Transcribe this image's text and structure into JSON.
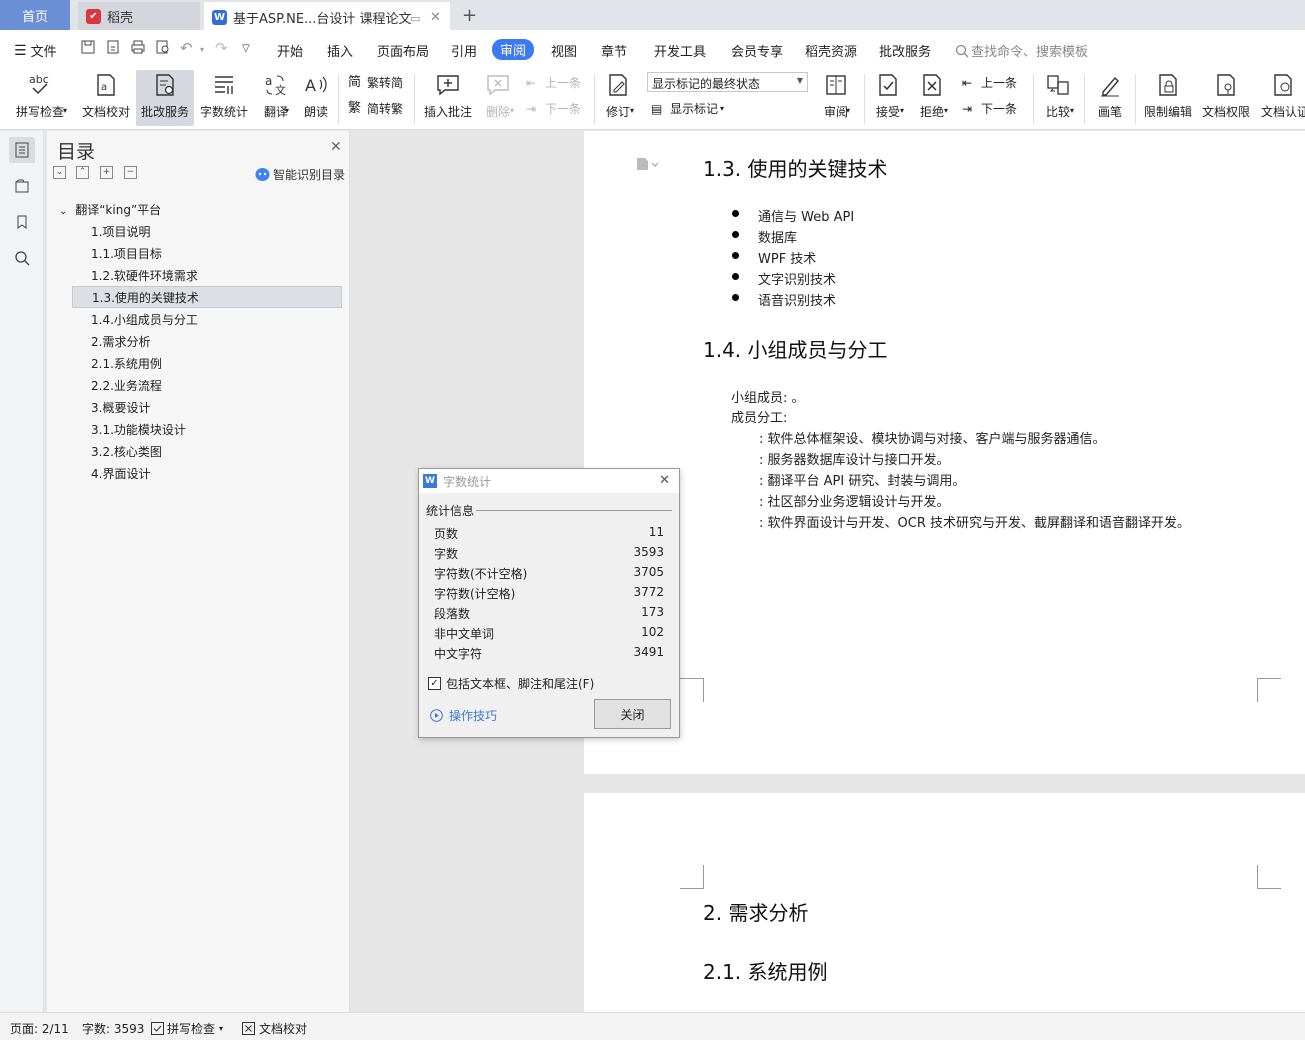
{
  "tabs": {
    "home": "首页",
    "daoke": "稻壳",
    "doc": "基于ASP.NE...台设计 课程论文"
  },
  "menu": {
    "file": "文件",
    "items": [
      "开始",
      "插入",
      "页面布局",
      "引用",
      "审阅",
      "视图",
      "章节",
      "开发工具",
      "会员专享",
      "稻壳资源",
      "批改服务"
    ],
    "active": "审阅",
    "search_placeholder": "查找命令、搜索模板"
  },
  "ribbon": {
    "spellcheck": "拼写检查",
    "doc_proof": "文档校对",
    "review_service": "批改服务",
    "word_count": "字数统计",
    "translate": "翻译",
    "read_aloud": "朗读",
    "trad_to_simp": "繁转简",
    "simp_to_trad": "简转繁",
    "insert_comment": "插入批注",
    "delete": "删除",
    "prev": "上一条",
    "next": "下一条",
    "revise": "修订",
    "markup_state": "显示标记的最终状态",
    "show_markup": "显示标记",
    "review": "审阅",
    "accept": "接受",
    "reject": "拒绝",
    "prev2": "上一条",
    "next2": "下一条",
    "compare": "比较",
    "pen": "画笔",
    "restrict_edit": "限制编辑",
    "doc_permission": "文档权限",
    "doc_certify": "文档认证"
  },
  "nav": {
    "title": "目录",
    "smart_toc": "智能识别目录",
    "root": "翻译“king”平台",
    "items": [
      "1.项目说明",
      "1.1.项目目标",
      "1.2.软硬件环境需求",
      "1.3.使用的关键技术",
      "1.4.小组成员与分工",
      "2.需求分析",
      "2.1.系统用例",
      "2.2.业务流程",
      "3.概要设计",
      "3.1.功能模块设计",
      "3.2.核心类图",
      "4.界面设计"
    ],
    "selected_index": 3
  },
  "document": {
    "h_1_3": "1.3. 使用的关键技术",
    "bullets": [
      "通信与 Web API",
      "数据库",
      "WPF 技术",
      "文字识别技术",
      "语音识别技术"
    ],
    "h_1_4": "1.4. 小组成员与分工",
    "members": "小组成员: 。",
    "division": "成员分工:",
    "tasks": [
      ": 软件总体框架设、模块协调与对接、客户端与服务器通信。",
      ": 服务器数据库设计与接口开发。",
      ": 翻译平台 API 研究、封装与调用。",
      ": 社区部分业务逻辑设计与开发。",
      ": 软件界面设计与开发、OCR 技术研究与开发、截屏翻译和语音翻译开发。"
    ],
    "h_2": "2. 需求分析",
    "h_2_1": "2.1. 系统用例"
  },
  "dialog": {
    "title": "字数统计",
    "group": "统计信息",
    "stats": [
      {
        "label": "页数",
        "value": "11"
      },
      {
        "label": "字数",
        "value": "3593"
      },
      {
        "label": "字符数(不计空格)",
        "value": "3705"
      },
      {
        "label": "字符数(计空格)",
        "value": "3772"
      },
      {
        "label": "段落数",
        "value": "173"
      },
      {
        "label": "非中文单词",
        "value": "102"
      },
      {
        "label": "中文字符",
        "value": "3491"
      }
    ],
    "include_label": "包括文本框、脚注和尾注(F)",
    "include_checked": true,
    "tips": "操作技巧",
    "close": "关闭"
  },
  "status": {
    "page": "页面: 2/11",
    "words": "字数: 3593",
    "spellcheck": "拼写检查",
    "proof": "文档校对"
  },
  "colors": {
    "accent": "#3b7af0",
    "home_tab": "#6b8fd6",
    "wps_red": "#d9363e",
    "doc_blue": "#2f6fd6"
  }
}
